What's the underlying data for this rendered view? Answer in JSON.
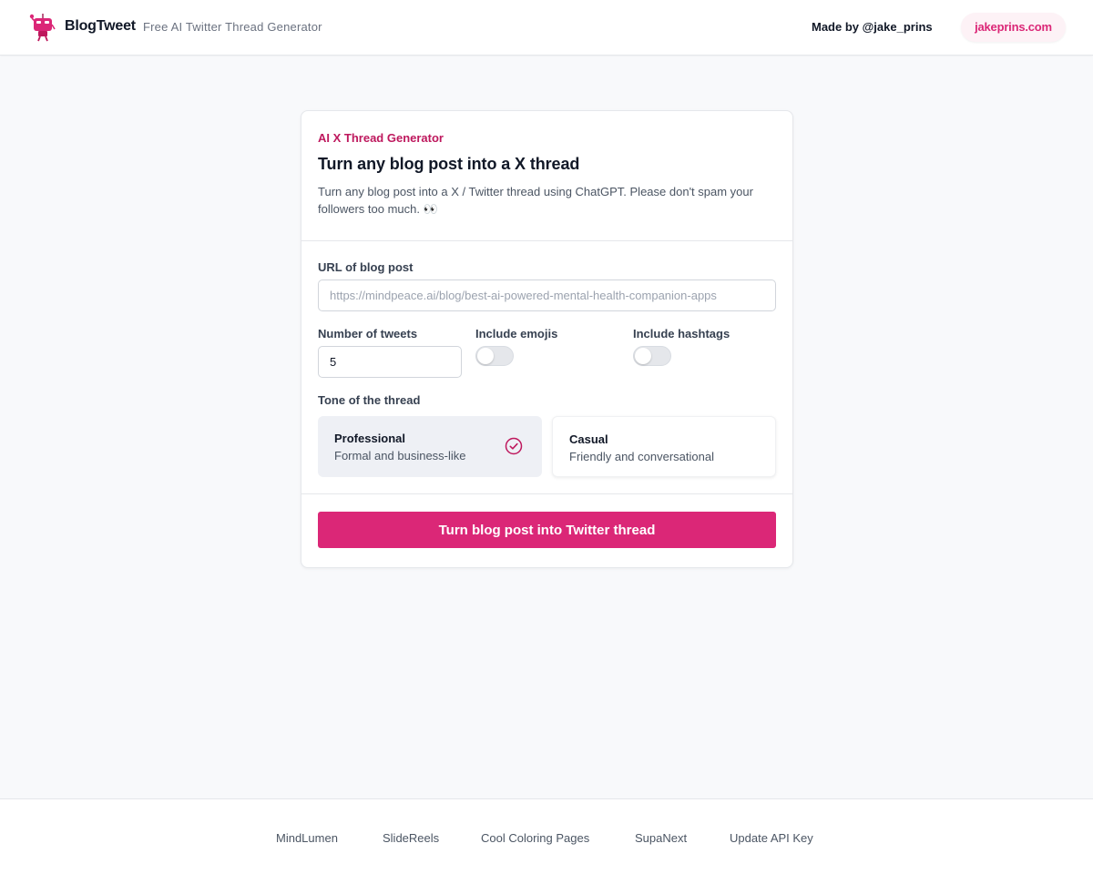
{
  "header": {
    "brand": "BlogTweet",
    "tagline": "Free AI Twitter Thread Generator",
    "made_by": "Made by @jake_prins",
    "site_link": "jakeprins.com",
    "logo_icon": "robot-icon"
  },
  "card": {
    "kicker": "AI X Thread Generator",
    "title": "Turn any blog post into a X thread",
    "description": "Turn any blog post into a X / Twitter thread using ChatGPT. Please don't spam your followers too much. 👀",
    "url_label": "URL of blog post",
    "url_placeholder": "https://mindpeace.ai/blog/best-ai-powered-mental-health-companion-apps",
    "url_value": "",
    "tweets_label": "Number of tweets",
    "tweets_value": "5",
    "emojis_label": "Include emojis",
    "emojis_on": false,
    "hashtags_label": "Include hashtags",
    "hashtags_on": false,
    "tone_label": "Tone of the thread",
    "tones": [
      {
        "title": "Professional",
        "subtitle": "Formal and business-like",
        "selected": true
      },
      {
        "title": "Casual",
        "subtitle": "Friendly and conversational",
        "selected": false
      }
    ],
    "submit_label": "Turn blog post into Twitter thread"
  },
  "footer": {
    "links": [
      "MindLumen",
      "SlideReels",
      "Cool Coloring Pages",
      "SupaNext",
      "Update API Key"
    ]
  },
  "colors": {
    "accent": "#db2777",
    "accent_dark": "#be185d",
    "background": "#f8f9fb"
  }
}
